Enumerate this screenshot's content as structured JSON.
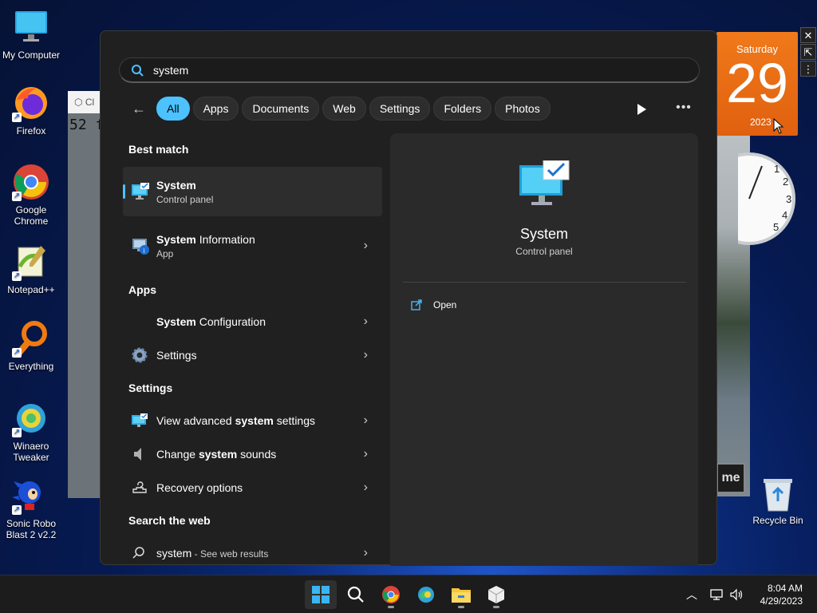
{
  "desktop": {
    "icons": [
      {
        "label": "My Computer"
      },
      {
        "label": "Firefox"
      },
      {
        "label": "Google Chrome"
      },
      {
        "label": "Notepad++"
      },
      {
        "label": "Everything"
      },
      {
        "label": "Winaero Tweaker"
      },
      {
        "label": "Sonic Robo Blast 2 v2.2"
      }
    ],
    "recycle_bin": "Recycle Bin",
    "background_window_text": "52 f",
    "background_window_title": "Cl",
    "game_button_text": "me",
    "calendar": {
      "day": "Saturday",
      "date": "29",
      "year": "2023"
    },
    "clock_numbers": [
      "1",
      "2",
      "3",
      "4",
      "5"
    ]
  },
  "search": {
    "query": "system",
    "filters": [
      "All",
      "Apps",
      "Documents",
      "Web",
      "Settings",
      "Folders",
      "Photos"
    ],
    "active_filter": "All",
    "best_match_header": "Best match",
    "best_match": {
      "title": "System",
      "subtitle": "Control panel"
    },
    "second_result": {
      "title_bold": "System",
      "title_rest": " Information",
      "subtitle": "App"
    },
    "apps_header": "Apps",
    "apps": [
      {
        "bold": "System",
        "rest": " Configuration",
        "icon": "system-configuration-icon"
      },
      {
        "bold": "",
        "rest": "Settings",
        "icon": "settings-gear-icon"
      }
    ],
    "settings_header": "Settings",
    "settings": [
      {
        "pre": "View advanced ",
        "bold": "system",
        "post": " settings",
        "icon": "advanced-system-settings-icon"
      },
      {
        "pre": "Change ",
        "bold": "system",
        "post": " sounds",
        "icon": "speaker-icon"
      },
      {
        "pre": "Recovery options",
        "bold": "",
        "post": "",
        "icon": "recovery-icon"
      }
    ],
    "web_header": "Search the web",
    "web": {
      "query": "system",
      "suffix": " - See web results"
    }
  },
  "detail": {
    "title": "System",
    "subtitle": "Control panel",
    "action": "Open"
  },
  "taskbar": {
    "apps": [
      "start-icon",
      "search-icon",
      "chrome-icon",
      "edge-icon",
      "file-explorer-icon",
      "cube-app-icon"
    ],
    "time": "8:04 AM",
    "date": "4/29/2023"
  },
  "colors": {
    "accent": "#4cc2ff",
    "panel": "#202020",
    "detail": "#2a2a2a",
    "taskbar": "#1c1c1c"
  }
}
